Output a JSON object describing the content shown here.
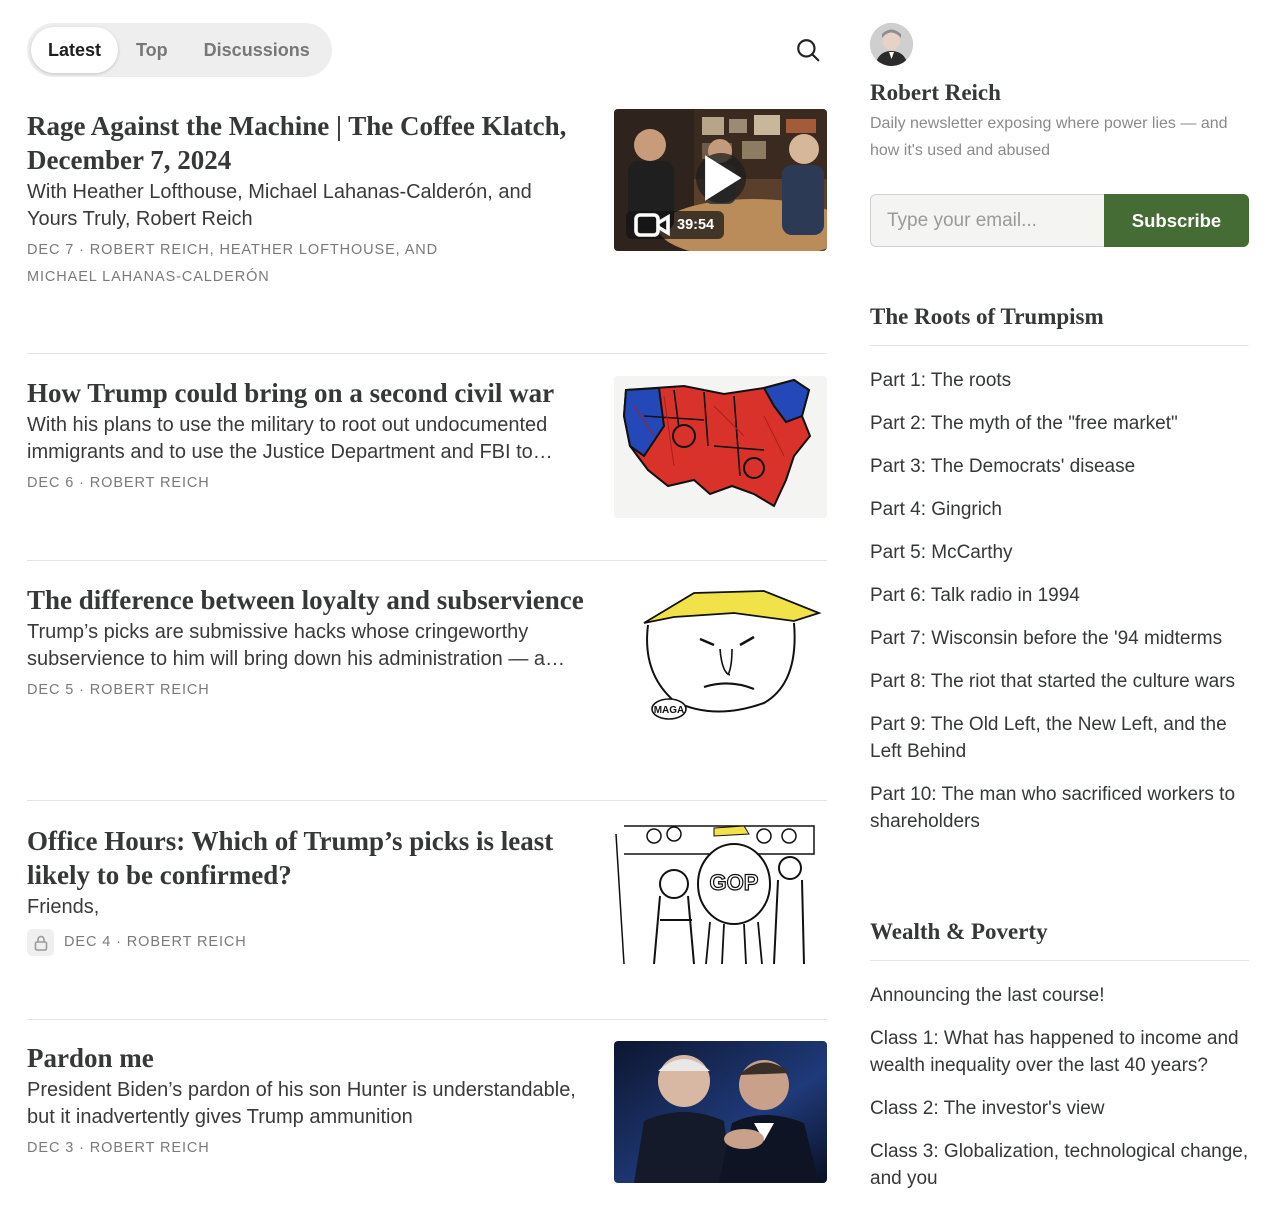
{
  "tabs": [
    "Latest",
    "Top",
    "Discussions"
  ],
  "posts": [
    {
      "title": "Rage Against the Machine | The Coffee Klatch, December 7, 2024",
      "subtitle": "With Heather Lofthouse, Michael Lahanas-Calderón, and Yours Truly, Robert Reich",
      "meta": "DEC 7 · ROBERT REICH, HEATHER LOFTHOUSE, AND MICHAEL LAHANAS-CALDERÓN",
      "video_duration": "39:54"
    },
    {
      "title": "How Trump could bring on a second civil war",
      "subtitle": "With his plans to use the military to root out undocumented immigrants and to use the Justice Department and FBI to…",
      "meta": "DEC 6 · ROBERT REICH"
    },
    {
      "title": "The difference between loyalty and subservience",
      "subtitle": "Trump’s picks are submissive hacks whose cringeworthy subservience to him will bring down his administration — a…",
      "meta": "DEC 5 · ROBERT REICH",
      "cartoon_label": "MAGA"
    },
    {
      "title": "Office Hours: Which of Trump’s picks is least likely to be confirmed?",
      "subtitle": "Friends,",
      "meta": "DEC 4 · ROBERT REICH",
      "cartoon_label": "GOP"
    },
    {
      "title": "Pardon me",
      "subtitle": "President Biden’s pardon of his son Hunter is understandable, but it inadvertently gives Trump ammunition",
      "meta": "DEC 3 · ROBERT REICH"
    }
  ],
  "sidebar": {
    "name": "Robert Reich",
    "description": "Daily newsletter exposing where power lies — and how it's used and abused",
    "email_placeholder": "Type your email...",
    "subscribe_label": "Subscribe",
    "sections": [
      {
        "title": "The Roots of Trumpism",
        "items": [
          "Part 1: The roots",
          "Part 2: The myth of the \"free market\"",
          "Part 3: The Democrats' disease",
          "Part 4: Gingrich",
          "Part 5: McCarthy",
          "Part 6: Talk radio in 1994",
          "Part 7: Wisconsin before the '94 midterms",
          "Part 8: The riot that started the culture wars",
          "Part 9: The Old Left, the New Left, and the Left Behind",
          "Part 10: The man who sacrificed workers to shareholders"
        ]
      },
      {
        "title": "Wealth & Poverty",
        "items": [
          "Announcing the last course!",
          "Class 1: What has happened to income and wealth inequality over the last 40 years?",
          "Class 2: The investor's view",
          "Class 3: Globalization, technological change, and you"
        ]
      }
    ]
  },
  "colors": {
    "accent": "#456c34",
    "text": "#363737",
    "meta": "#7a7a7a"
  }
}
